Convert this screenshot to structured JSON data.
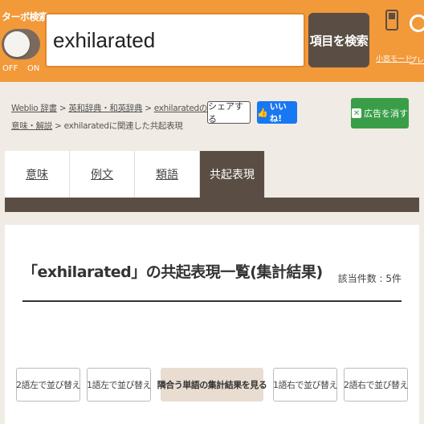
{
  "header": {
    "turbo_label": "ターボ検索",
    "toggle_off": "OFF",
    "toggle_on": "ON",
    "search_value": "exhilarated",
    "search_button": "項目を検索",
    "mini_mode": "小窓モード",
    "premium": "プレミ"
  },
  "breadcrumb": {
    "items": [
      "Weblio 辞書",
      "英和辞典・和英辞典",
      "exhilaratedの意味・解説",
      "exhilaratedに関連した共起表現"
    ],
    "sep": ">"
  },
  "share_button": "シェアする",
  "like_button": "いいね!",
  "ad_button": "広告を消す",
  "tabs": [
    {
      "label": "意味"
    },
    {
      "label": "例文"
    },
    {
      "label": "類語"
    },
    {
      "label": "共起表現"
    }
  ],
  "main": {
    "heading": "「exhilarated」の共起表現一覧(集計結果)",
    "count": "該当件数 : 5件"
  },
  "sort_buttons": [
    {
      "label": "2語左で並び替え"
    },
    {
      "label": "1語左で並び替え"
    },
    {
      "label": "隣合う単語の集計結果を見る"
    },
    {
      "label": "1語右で並び替え"
    },
    {
      "label": "2語右で並び替え"
    }
  ],
  "colors": {
    "header_bg": "#f2993a",
    "dark_brown": "#5a4e44",
    "ad_green": "#3a9e48",
    "fb_blue": "#1877f2"
  }
}
